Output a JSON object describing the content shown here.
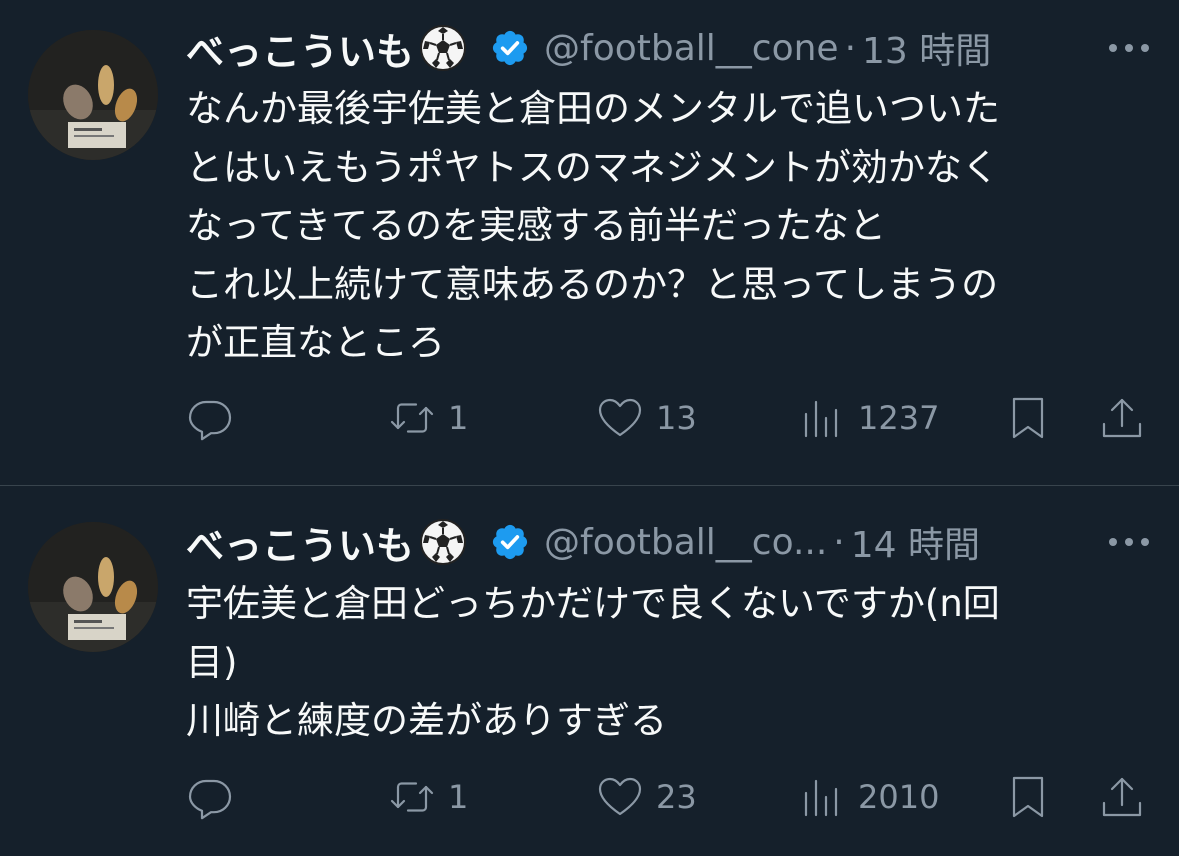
{
  "tweets": [
    {
      "display_name": "べっこういも",
      "name_emoji": "soccer-ball-emoji",
      "verified_badge": "verified-badge-icon",
      "handle": "@football__cone",
      "separator": "·",
      "time": "13 時間",
      "text": "なんか最後宇佐美と倉田のメンタルで追いついた\nとはいえもうポヤトスのマネジメントが効かなく\nなってきてるのを実感する前半だったなと\nこれ以上続けて意味あるのか？と思ってしまうの\nが正直なところ",
      "reply_count": "",
      "retweet_count": "1",
      "like_count": "13",
      "view_count": "1237"
    },
    {
      "display_name": "べっこういも",
      "name_emoji": "soccer-ball-emoji",
      "verified_badge": "verified-badge-icon",
      "handle": "@football__co...",
      "separator": "·",
      "time": "14 時間",
      "text": "宇佐美と倉田どっちかだけで良くないですか(n回\n目)\n川崎と練度の差がありすぎる",
      "reply_count": "",
      "retweet_count": "1",
      "like_count": "23",
      "view_count": "2010"
    }
  ],
  "colors": {
    "background": "#15202b",
    "text_primary": "#f7f9f9",
    "text_secondary": "#8b98a5",
    "verified_blue": "#1d9bf0",
    "divider": "#38444d"
  },
  "icons": {
    "reply": "reply-icon",
    "retweet": "retweet-icon",
    "like": "heart-icon",
    "views": "views-icon",
    "bookmark": "bookmark-icon",
    "share": "share-icon",
    "more": "more-icon"
  }
}
